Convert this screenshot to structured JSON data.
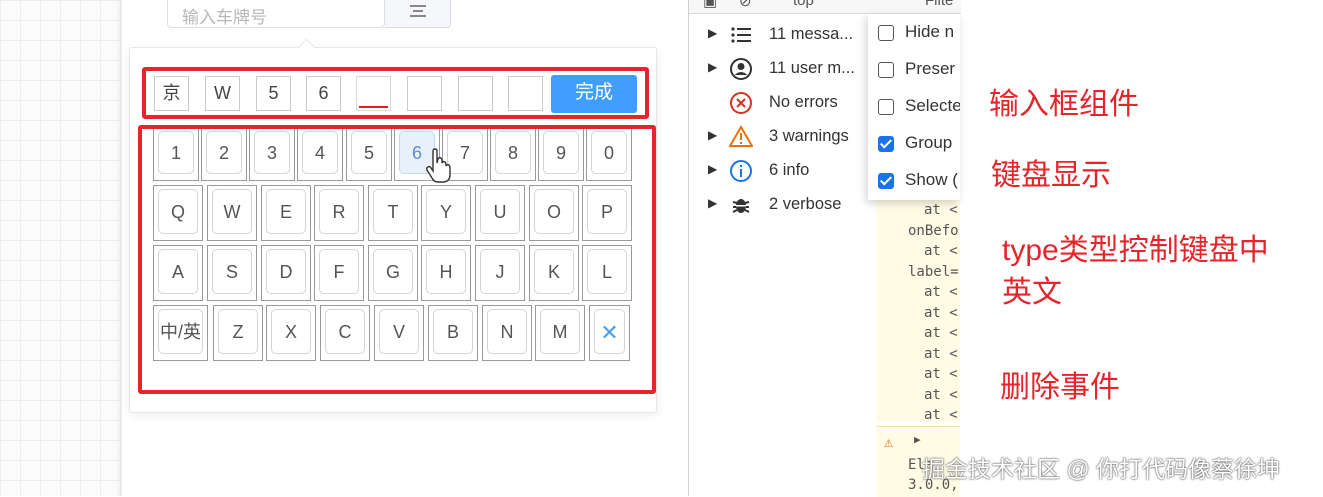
{
  "input": {
    "placeholder": "输入车牌号"
  },
  "plate_cells": [
    "京",
    "W",
    "5",
    "6",
    "",
    "",
    "",
    ""
  ],
  "done_label": "完成",
  "keyboard": {
    "row1": [
      "1",
      "2",
      "3",
      "4",
      "5",
      "6",
      "7",
      "8",
      "9",
      "0"
    ],
    "row2": [
      "Q",
      "W",
      "E",
      "R",
      "T",
      "Y",
      "U",
      "O",
      "P"
    ],
    "row3": [
      "A",
      "S",
      "D",
      "F",
      "G",
      "H",
      "J",
      "K",
      "L"
    ],
    "row4_toggle": "中/英",
    "row4": [
      "Z",
      "X",
      "C",
      "V",
      "B",
      "N",
      "M"
    ],
    "delete_key": "✕",
    "highlighted_key": "6"
  },
  "devtools": {
    "top_partial": [
      "top",
      "Filte"
    ],
    "rows": [
      {
        "label": "11 messa...",
        "icon": "list-icon",
        "expandable": true
      },
      {
        "label": "11 user m...",
        "icon": "user-icon",
        "expandable": true
      },
      {
        "label": "No errors",
        "icon": "error-icon",
        "expandable": false
      },
      {
        "label": "3 warnings",
        "icon": "warning-icon",
        "expandable": true
      },
      {
        "label": "6 info",
        "icon": "info-icon",
        "expandable": true
      },
      {
        "label": "2 verbose",
        "icon": "bug-icon",
        "expandable": true
      }
    ],
    "menu": [
      {
        "label": "Hide n",
        "checked": false
      },
      {
        "label": "Preser",
        "checked": false
      },
      {
        "label": "Selecte",
        "checked": false
      },
      {
        "label": "Group",
        "checked": true
      },
      {
        "label": "Show (",
        "checked": true
      }
    ],
    "code_lines": [
      "at <",
      "onBefo",
      "at <",
      "label=",
      "at <",
      "at <",
      "at <",
      "at <",
      "at <",
      "at <",
      "at <"
    ],
    "warning_lines": [
      "Ele",
      "3.0.0,"
    ]
  },
  "annotations": {
    "input_component": "输入框组件",
    "keyboard_display": "键盘显示",
    "type_control_line1": "type类型控制键盘中",
    "type_control_line2": "英文",
    "delete_event": "删除事件"
  },
  "watermark": "掘金技术社区 @ 你打代码像蔡徐坤",
  "colors": {
    "annotation_red": "#e5252b",
    "primary_blue": "#409eff",
    "active_underline": "#e02020"
  }
}
